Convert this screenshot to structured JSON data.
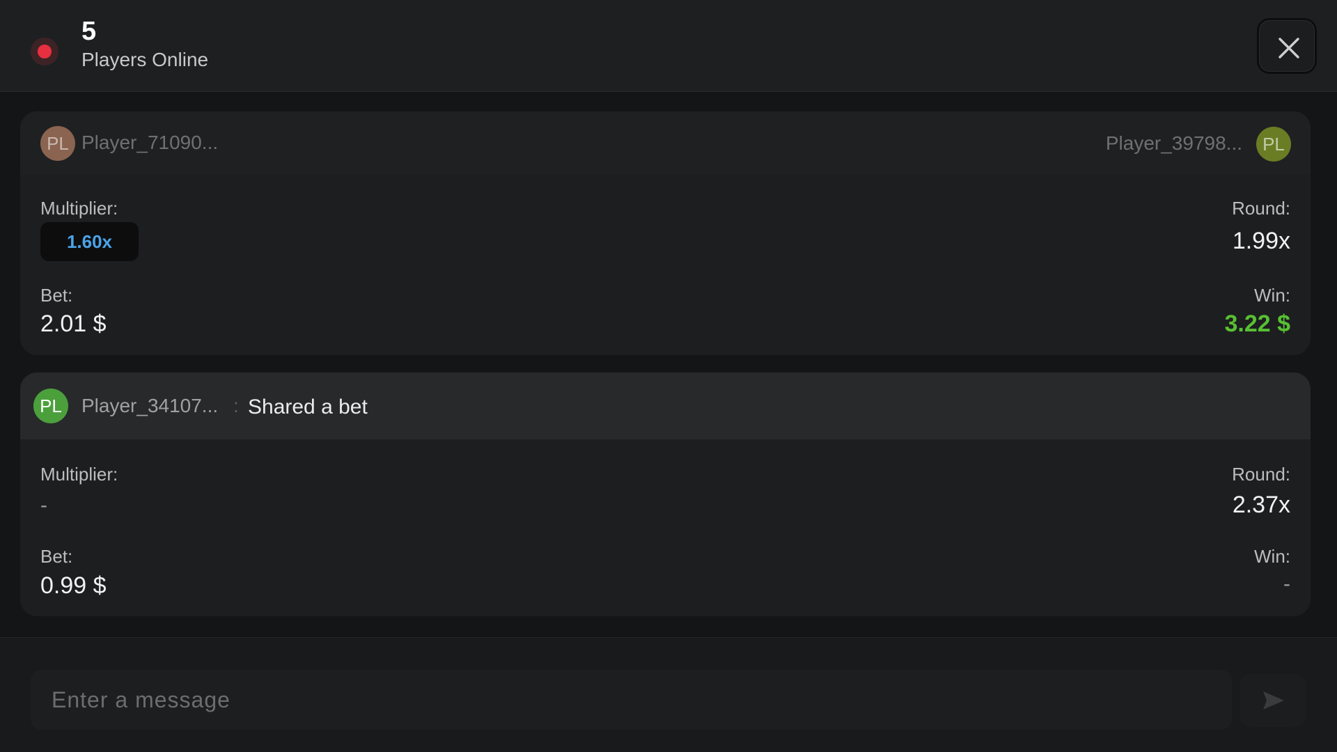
{
  "header": {
    "online_count": "5",
    "online_label": "Players Online"
  },
  "feed": {
    "cards": [
      {
        "player_left": {
          "avatar": "PL",
          "name": "Player_71090..."
        },
        "player_right": {
          "avatar": "PL",
          "name": "Player_39798..."
        },
        "multiplier_label": "Multiplier:",
        "multiplier_value": "1.60x",
        "round_label": "Round:",
        "round_value": "1.99x",
        "bet_label": "Bet:",
        "bet_value": "2.01 $",
        "win_label": "Win:",
        "win_value": "3.22 $"
      },
      {
        "player": {
          "avatar": "PL",
          "name": "Player_34107..."
        },
        "separator": ":",
        "action": "Shared a bet",
        "multiplier_label": "Multiplier:",
        "multiplier_value": "-",
        "round_label": "Round:",
        "round_value": "2.37x",
        "bet_label": "Bet:",
        "bet_value": "0.99 $",
        "win_label": "Win:",
        "win_value": "-"
      }
    ]
  },
  "composer": {
    "placeholder": "Enter a message",
    "value": ""
  },
  "icons": {
    "status": "online-dot-icon",
    "close": "close-icon",
    "send": "send-icon"
  },
  "colors": {
    "online_dot": "#e6303f",
    "multiplier_accent": "#4aa3e8",
    "win_green": "#58c033",
    "background": "#141516"
  }
}
